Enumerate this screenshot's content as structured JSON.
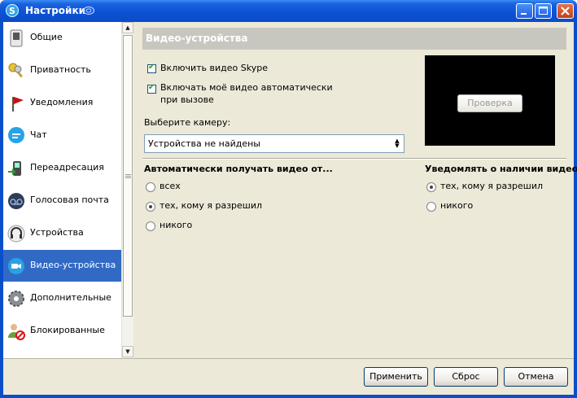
{
  "window": {
    "title": "Настройки"
  },
  "sidebar": {
    "items": [
      {
        "label": "Общие",
        "icon": "switch-icon"
      },
      {
        "label": "Приватность",
        "icon": "keys-icon"
      },
      {
        "label": "Уведомления",
        "icon": "flag-icon"
      },
      {
        "label": "Чат",
        "icon": "chat-bubble-icon"
      },
      {
        "label": "Переадресация",
        "icon": "phone-forward-icon"
      },
      {
        "label": "Голосовая почта",
        "icon": "voicemail-icon"
      },
      {
        "label": "Устройства",
        "icon": "headset-icon"
      },
      {
        "label": "Видео-устройства",
        "icon": "video-camera-icon",
        "selected": true
      },
      {
        "label": "Дополнительные",
        "icon": "gear-icon"
      },
      {
        "label": "Блокированные",
        "icon": "blocked-user-icon"
      },
      {
        "label": "",
        "icon": "arrow-icon"
      }
    ]
  },
  "panel": {
    "header": "Видео-устройства",
    "enable_video_label": "Включить видео Skype",
    "auto_video_label_line1": "Включать моё видео автоматически",
    "auto_video_label_line2": "при вызове",
    "camera_label": "Выберите камеру:",
    "camera_select_value": "Устройства не найдены",
    "preview_button": "Проверка",
    "receive_group": {
      "title": "Автоматически получать видео от...",
      "options": [
        "всех",
        "тех, кому я разрешил",
        "никого"
      ],
      "selected": 1
    },
    "notify_group": {
      "title": "Уведомлять о наличии видео...",
      "options": [
        "тех, кому я разрешил",
        "никого"
      ],
      "selected": 0
    }
  },
  "buttons": {
    "apply": "Применить",
    "reset": "Сброс",
    "cancel": "Отмена"
  }
}
